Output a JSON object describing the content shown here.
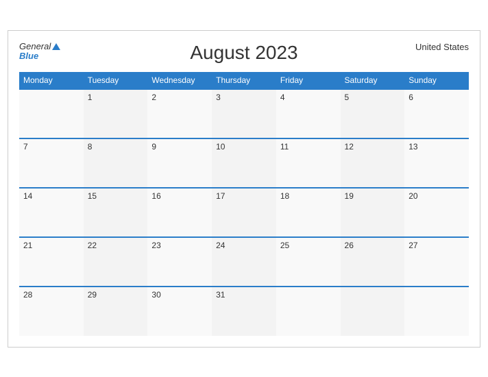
{
  "header": {
    "title": "August 2023",
    "country": "United States",
    "logo_general": "General",
    "logo_blue": "Blue"
  },
  "weekdays": [
    "Monday",
    "Tuesday",
    "Wednesday",
    "Thursday",
    "Friday",
    "Saturday",
    "Sunday"
  ],
  "weeks": [
    [
      "",
      "1",
      "2",
      "3",
      "4",
      "5",
      "6"
    ],
    [
      "7",
      "8",
      "9",
      "10",
      "11",
      "12",
      "13"
    ],
    [
      "14",
      "15",
      "16",
      "17",
      "18",
      "19",
      "20"
    ],
    [
      "21",
      "22",
      "23",
      "24",
      "25",
      "26",
      "27"
    ],
    [
      "28",
      "29",
      "30",
      "31",
      "",
      "",
      ""
    ]
  ]
}
